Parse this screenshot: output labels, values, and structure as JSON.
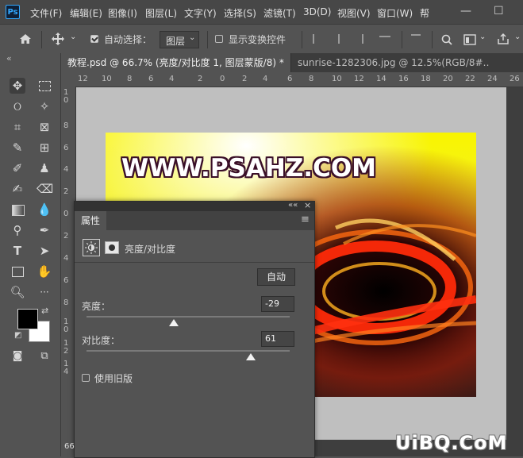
{
  "app": {
    "logo": "Ps"
  },
  "menu": [
    "文件(F)",
    "编辑(E)",
    "图像(I)",
    "图层(L)",
    "文字(Y)",
    "选择(S)",
    "滤镜(T)",
    "3D(D)",
    "视图(V)",
    "窗口(W)",
    "帮"
  ],
  "window_controls": {
    "minimize": "—",
    "maximize": "☐"
  },
  "options_bar": {
    "auto_select_label": "自动选择：",
    "auto_select_checked": true,
    "auto_select_value": "图层",
    "show_transform_label": "显示变换控件",
    "show_transform_checked": false
  },
  "tabs": [
    {
      "label": "教程.psd @ 66.7% (亮度/对比度 1, 图层蒙版/8) *",
      "close": "×",
      "active": true
    },
    {
      "label": "sunrise-1282306.jpg @ 12.5%(RGB/8#…",
      "active": false
    }
  ],
  "ruler_top": [
    "12",
    "10",
    "8",
    "6",
    "4",
    "2",
    "0",
    "2",
    "4",
    "6",
    "8",
    "10",
    "12",
    "14",
    "16",
    "18",
    "20",
    "22",
    "24",
    "26"
  ],
  "ruler_left": [
    "1",
    "0",
    "8",
    "6",
    "4",
    "2",
    "0",
    "2",
    "4",
    "6",
    "8",
    "1",
    "0",
    "1",
    "2",
    "1",
    "4"
  ],
  "toolbar": {
    "collapse": "«"
  },
  "image": {
    "watermark": "WWW.PSAHZ.COM"
  },
  "properties_panel": {
    "tab_label": "属性",
    "collapse": "««",
    "close": "×",
    "menu_icon": "≡",
    "layer_label": "亮度/对比度",
    "auto_button": "自动",
    "brightness_label": "亮度：",
    "brightness_value": "-29",
    "brightness_pct": 0.43,
    "contrast_label": "对比度：",
    "contrast_value": "61",
    "contrast_pct": 0.81,
    "legacy_label": "使用旧版",
    "legacy_checked": false
  },
  "status": {
    "zoom": "66"
  },
  "site_watermark": "UiBQ.CoM",
  "colors": {
    "accent": "#31a8ff",
    "panel": "#535353",
    "canvas": "#bfbfbf"
  }
}
